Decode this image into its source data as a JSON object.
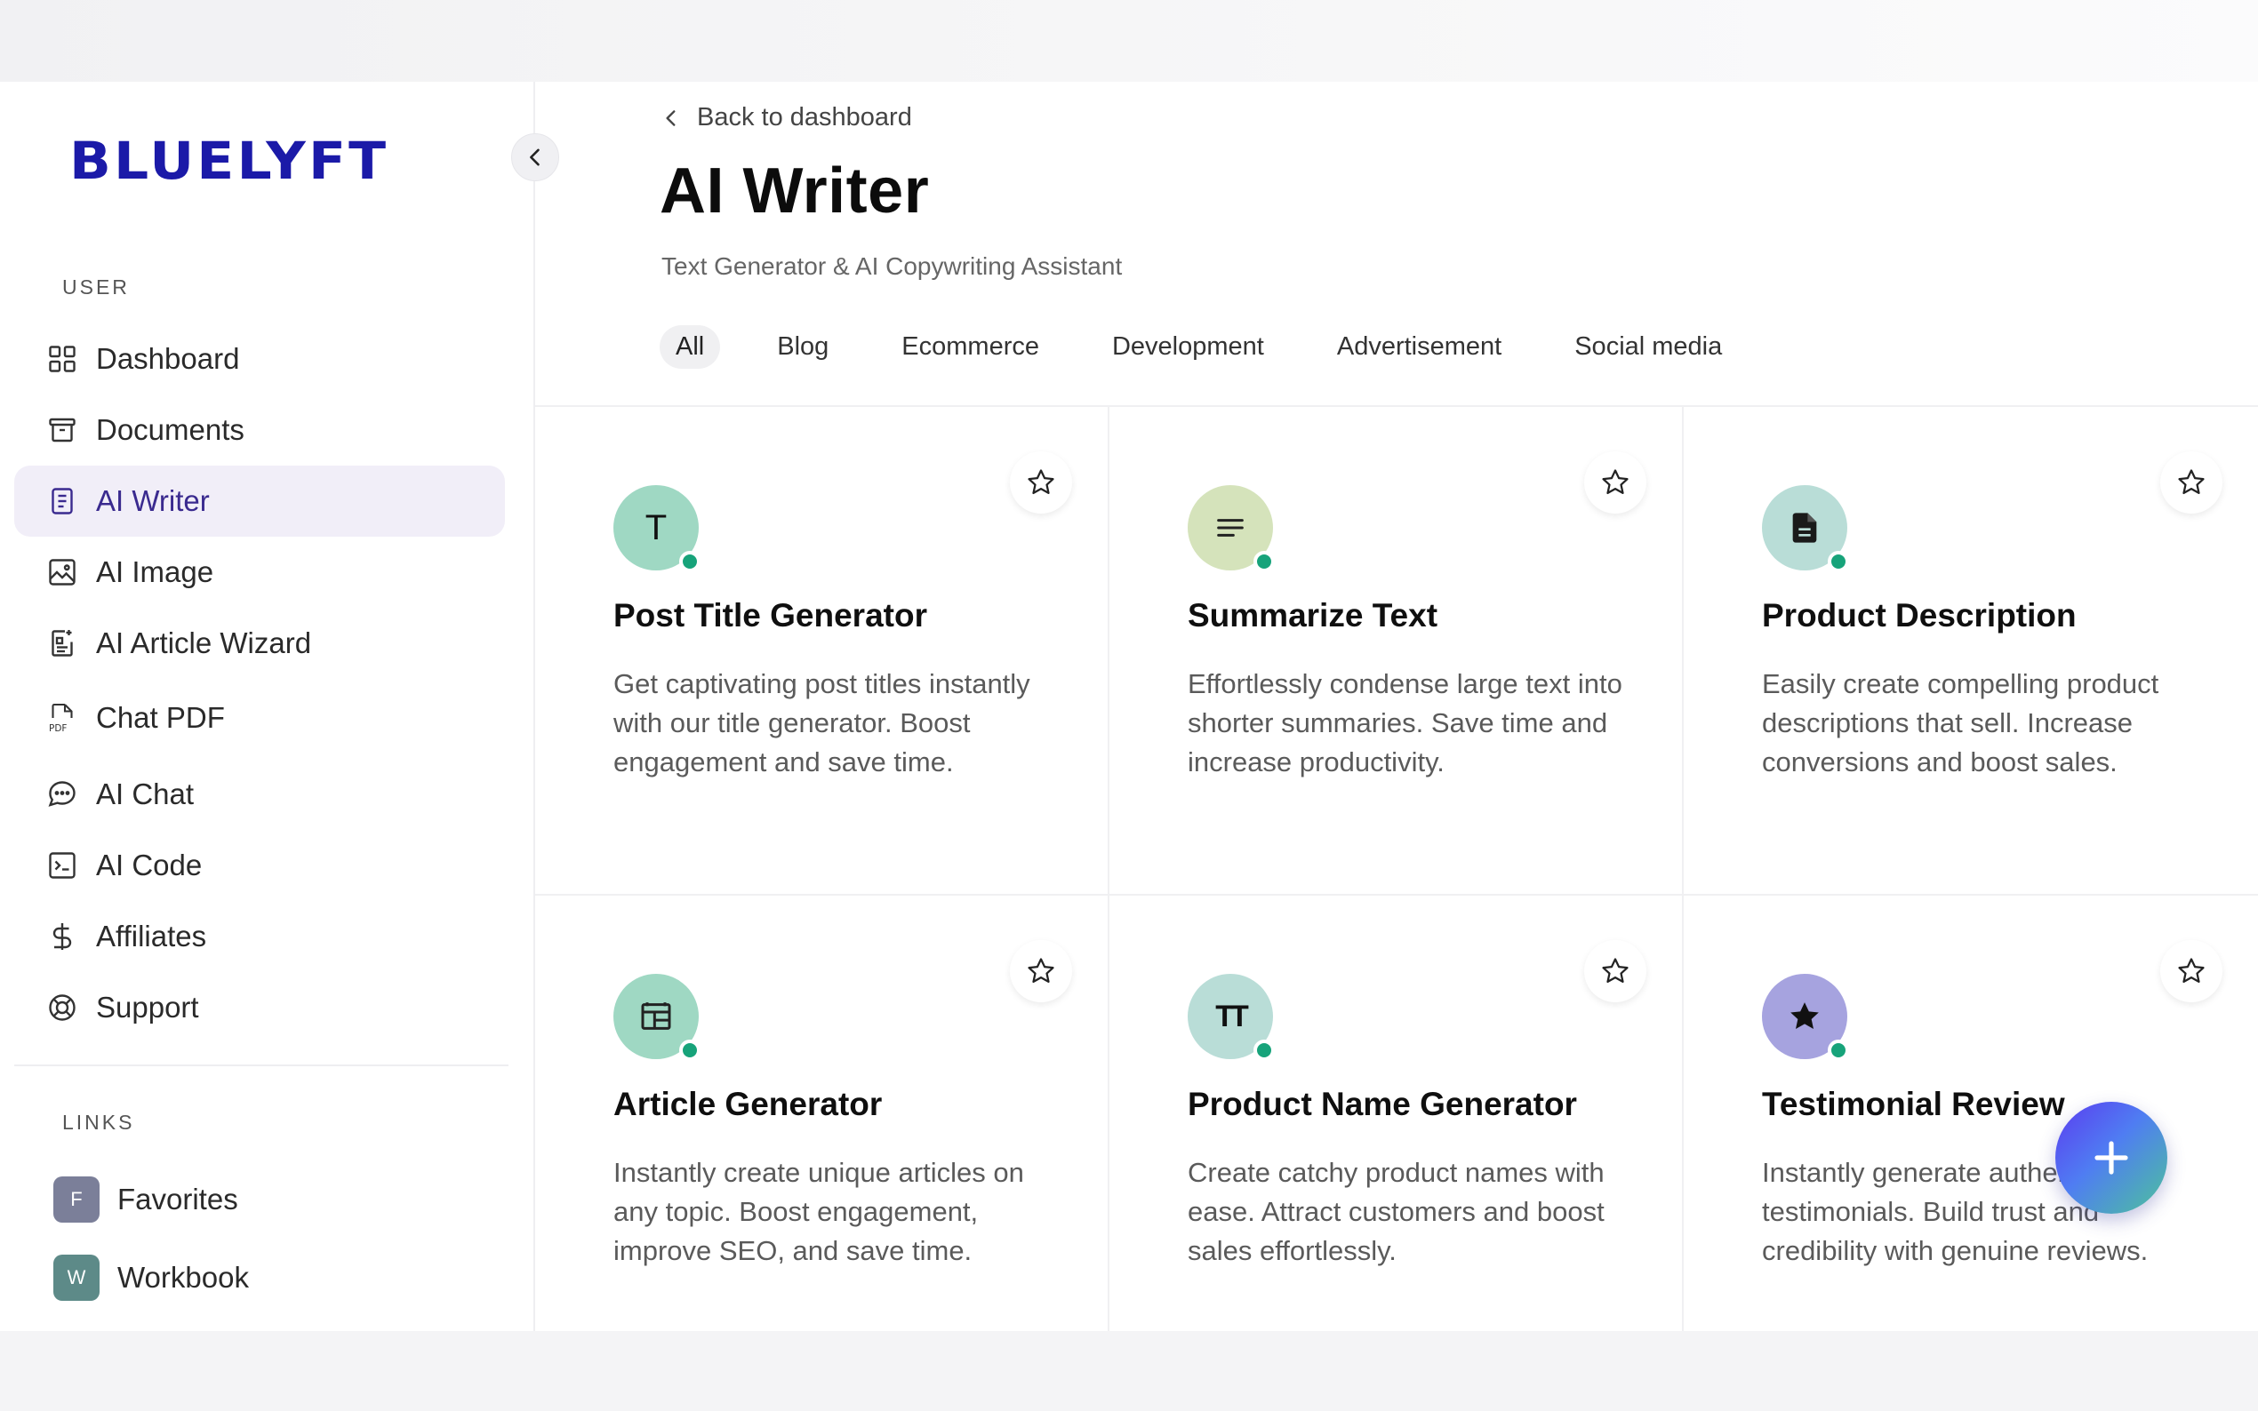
{
  "brand": {
    "logo_text": "BLUELYFT",
    "logo_color": "#1b1aa8"
  },
  "sidebar": {
    "user_section_label": "USER",
    "items": [
      {
        "label": "Dashboard",
        "icon": "grid-icon",
        "active": false
      },
      {
        "label": "Documents",
        "icon": "archive-icon",
        "active": false
      },
      {
        "label": "AI Writer",
        "icon": "document-icon",
        "active": true
      },
      {
        "label": "AI Image",
        "icon": "image-icon",
        "active": false
      },
      {
        "label": "AI Article Wizard",
        "icon": "wizard-icon",
        "active": false
      },
      {
        "label": "Chat PDF",
        "icon": "pdf-icon",
        "active": false
      },
      {
        "label": "AI Chat",
        "icon": "chat-icon",
        "active": false
      },
      {
        "label": "AI Code",
        "icon": "terminal-icon",
        "active": false
      },
      {
        "label": "Affiliates",
        "icon": "dollar-icon",
        "active": false
      },
      {
        "label": "Support",
        "icon": "lifebuoy-icon",
        "active": false
      }
    ],
    "links_section_label": "LINKS",
    "links": [
      {
        "badge": "F",
        "label": "Favorites",
        "color": "#7b7f99"
      },
      {
        "badge": "W",
        "label": "Workbook",
        "color": "#5d8a88"
      }
    ]
  },
  "header": {
    "back_label": "Back to dashboard",
    "title": "AI Writer",
    "subtitle": "Text Generator & AI Copywriting Assistant"
  },
  "tabs": [
    {
      "label": "All",
      "active": true
    },
    {
      "label": "Blog",
      "active": false
    },
    {
      "label": "Ecommerce",
      "active": false
    },
    {
      "label": "Development",
      "active": false
    },
    {
      "label": "Advertisement",
      "active": false
    },
    {
      "label": "Social media",
      "active": false
    }
  ],
  "cards": [
    {
      "title": "Post Title Generator",
      "description": "Get captivating post titles instantly with our title generator. Boost engagement and save time.",
      "icon": "letter-t-icon",
      "icon_glyph": "T",
      "icon_bg": "#9fd8c3"
    },
    {
      "title": "Summarize Text",
      "description": "Effortlessly condense large text into shorter summaries. Save time and increase productivity.",
      "icon": "lines-icon",
      "icon_glyph": "",
      "icon_bg": "#d5e3bb"
    },
    {
      "title": "Product Description",
      "description": "Easily create compelling product descriptions that sell. Increase conversions and boost sales.",
      "icon": "file-icon",
      "icon_glyph": "",
      "icon_bg": "#b9ddd7"
    },
    {
      "title": "Article Generator",
      "description": "Instantly create unique articles on any topic. Boost engagement, improve SEO, and save time.",
      "icon": "layout-icon",
      "icon_glyph": "",
      "icon_bg": "#9fd8c3"
    },
    {
      "title": "Product Name Generator",
      "description": "Create catchy product names with ease. Attract customers and boost sales effortlessly.",
      "icon": "text-size-icon",
      "icon_glyph": "TT",
      "icon_bg": "#b9ddd7"
    },
    {
      "title": "Testimonial Review",
      "description": "Instantly generate authentic testimonials. Build trust and credibility with genuine reviews.",
      "icon": "star-filled-icon",
      "icon_glyph": "",
      "icon_bg": "#a6a3df"
    }
  ],
  "fab": {
    "icon": "plus-icon"
  },
  "colors": {
    "status_online": "#17a37a",
    "active_bg": "#f1eef8",
    "active_text": "#3a2a8f"
  }
}
